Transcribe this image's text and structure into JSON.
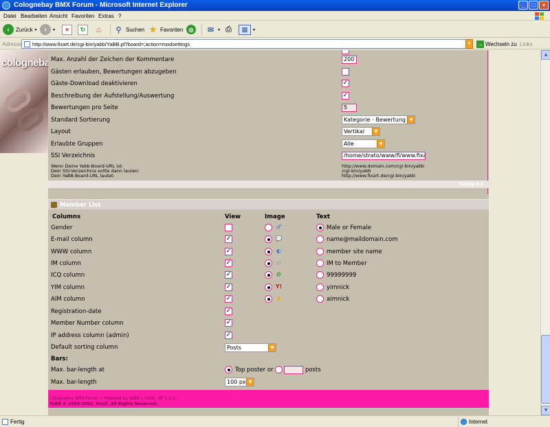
{
  "window": {
    "title": "Colognebay BMX Forum - Microsoft Internet Explorer"
  },
  "menu": [
    "Datei",
    "Bearbeiten",
    "Ansicht",
    "Favoriten",
    "Extras",
    "?"
  ],
  "toolbar": {
    "back": "Zurück",
    "search": "Suchen",
    "favorites": "Favoriten"
  },
  "address": {
    "label": "Adresse",
    "url": "http://www.fixart.de/cgi-bin/yabb/YaBB.pl?board=;action=modsettings",
    "go": "Wechseln zu",
    "links": "Links"
  },
  "sidebar": {
    "logo": "colognebay"
  },
  "settings": {
    "rows": [
      {
        "label": "Max. Anzahl der Zeichen der Kommentare",
        "value": "200"
      },
      {
        "label": "Gästen erlauben, Bewertungen abzugeben",
        "checked": false
      },
      {
        "label": "Gäste-Download deaktivieren",
        "checked": true
      },
      {
        "label": "Beschreibung der Aufstellung/Auswertung",
        "checked": true
      },
      {
        "label": "Bewertungen pro Seite",
        "value": "5"
      },
      {
        "label": "Standard Sortierung",
        "value": "Kategorie - Bewertung"
      },
      {
        "label": "Layout",
        "value": "Vertikal"
      },
      {
        "label": "Erlaubte Gruppen",
        "value": "Alle"
      },
      {
        "label": "SSI Verzeichnis",
        "value": "/home/strato/www/fi/www.fixa"
      }
    ],
    "info_left": [
      "Wenn Deine Yabb-Board-URL ist:",
      "Dein SSI-Verzeichnis sollte dann lauten:",
      "Dein YaBB-Board-URL lautet:"
    ],
    "info_right": [
      "http://www.domain.com/cgi-bin/yabb",
      "/cgi-bin/yabb",
      "http://www.fixart.de/cgi-bin/yabb"
    ],
    "version": "Rating 4.3"
  },
  "memberlist": {
    "title": "Member List",
    "headers": {
      "columns": "Columns",
      "view": "View",
      "image": "Image",
      "text": "Text"
    },
    "rows": [
      {
        "label": "Gender",
        "view": false,
        "image": false,
        "icon": "gender-icon",
        "text": "Male or Female",
        "textsel": true
      },
      {
        "label": "E-mail column",
        "view": true,
        "image": true,
        "icon": "email-icon",
        "text": "name@maildomain.com",
        "textsel": false
      },
      {
        "label": "WWW column",
        "view": true,
        "image": true,
        "icon": "www-icon",
        "text": "member site name",
        "textsel": false
      },
      {
        "label": "IM column",
        "view": true,
        "image": true,
        "icon": "im-icon",
        "text": "IM to Member",
        "textsel": false
      },
      {
        "label": "ICQ column",
        "view": true,
        "image": true,
        "icon": "icq-icon",
        "text": "99999999",
        "textsel": false
      },
      {
        "label": "YIM column",
        "view": true,
        "image": true,
        "icon": "yim-icon",
        "text": "yimnick",
        "textsel": false
      },
      {
        "label": "AIM column",
        "view": true,
        "image": true,
        "icon": "aim-icon",
        "text": "aimnick",
        "textsel": false
      },
      {
        "label": "Registration-date",
        "view": true
      },
      {
        "label": "Member Number column",
        "view": true
      },
      {
        "label": "IP address column (admin)",
        "view": true
      }
    ],
    "sorting": {
      "label": "Default sorting column",
      "value": "Posts"
    },
    "bars": {
      "heading": "Bars:",
      "length_label": "Max. bar-length at",
      "top_poster": "Top poster or",
      "posts": "posts",
      "max_length_label": "Max. bar-length",
      "max_length_value": "100 px"
    }
  },
  "footer": {
    "line1": "Colognebay BMX Forum » Powered by YaBB 1 Gold - SP 1.3.1!",
    "line2": "YaBB © 2000-2002, Xnull. All Rights Reserved."
  },
  "status": {
    "text": "Fertig",
    "zone": "Internet"
  },
  "colors": {
    "accent": "#e02d8f",
    "footer": "#ff1aa6",
    "panel": "#c6bfb0"
  }
}
